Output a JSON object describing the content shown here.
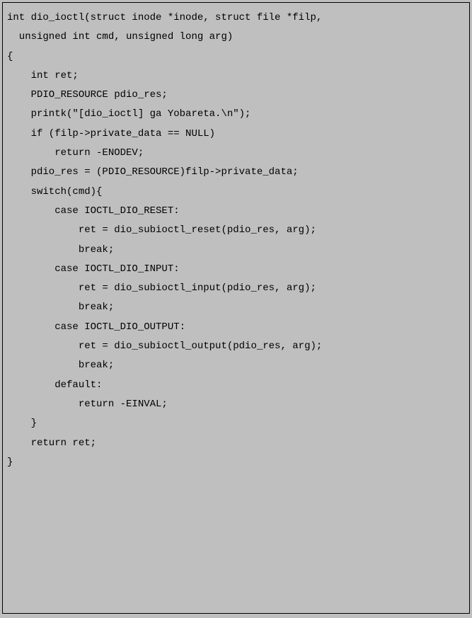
{
  "code": {
    "lines": [
      "int dio_ioctl(struct inode *inode, struct file *filp,",
      "  unsigned int cmd, unsigned long arg)",
      "{",
      "    int ret;",
      "    PDIO_RESOURCE pdio_res;",
      "",
      "    printk(\"[dio_ioctl] ga Yobareta.\\n\");",
      "",
      "    if (filp->private_data == NULL)",
      "        return -ENODEV;",
      "    pdio_res = (PDIO_RESOURCE)filp->private_data;",
      "",
      "    switch(cmd){",
      "        case IOCTL_DIO_RESET:",
      "            ret = dio_subioctl_reset(pdio_res, arg);",
      "            break;",
      "        case IOCTL_DIO_INPUT:",
      "            ret = dio_subioctl_input(pdio_res, arg);",
      "            break;",
      "        case IOCTL_DIO_OUTPUT:",
      "            ret = dio_subioctl_output(pdio_res, arg);",
      "            break;",
      "        default:",
      "            return -EINVAL;",
      "    }",
      "",
      "    return ret;",
      "}"
    ]
  }
}
